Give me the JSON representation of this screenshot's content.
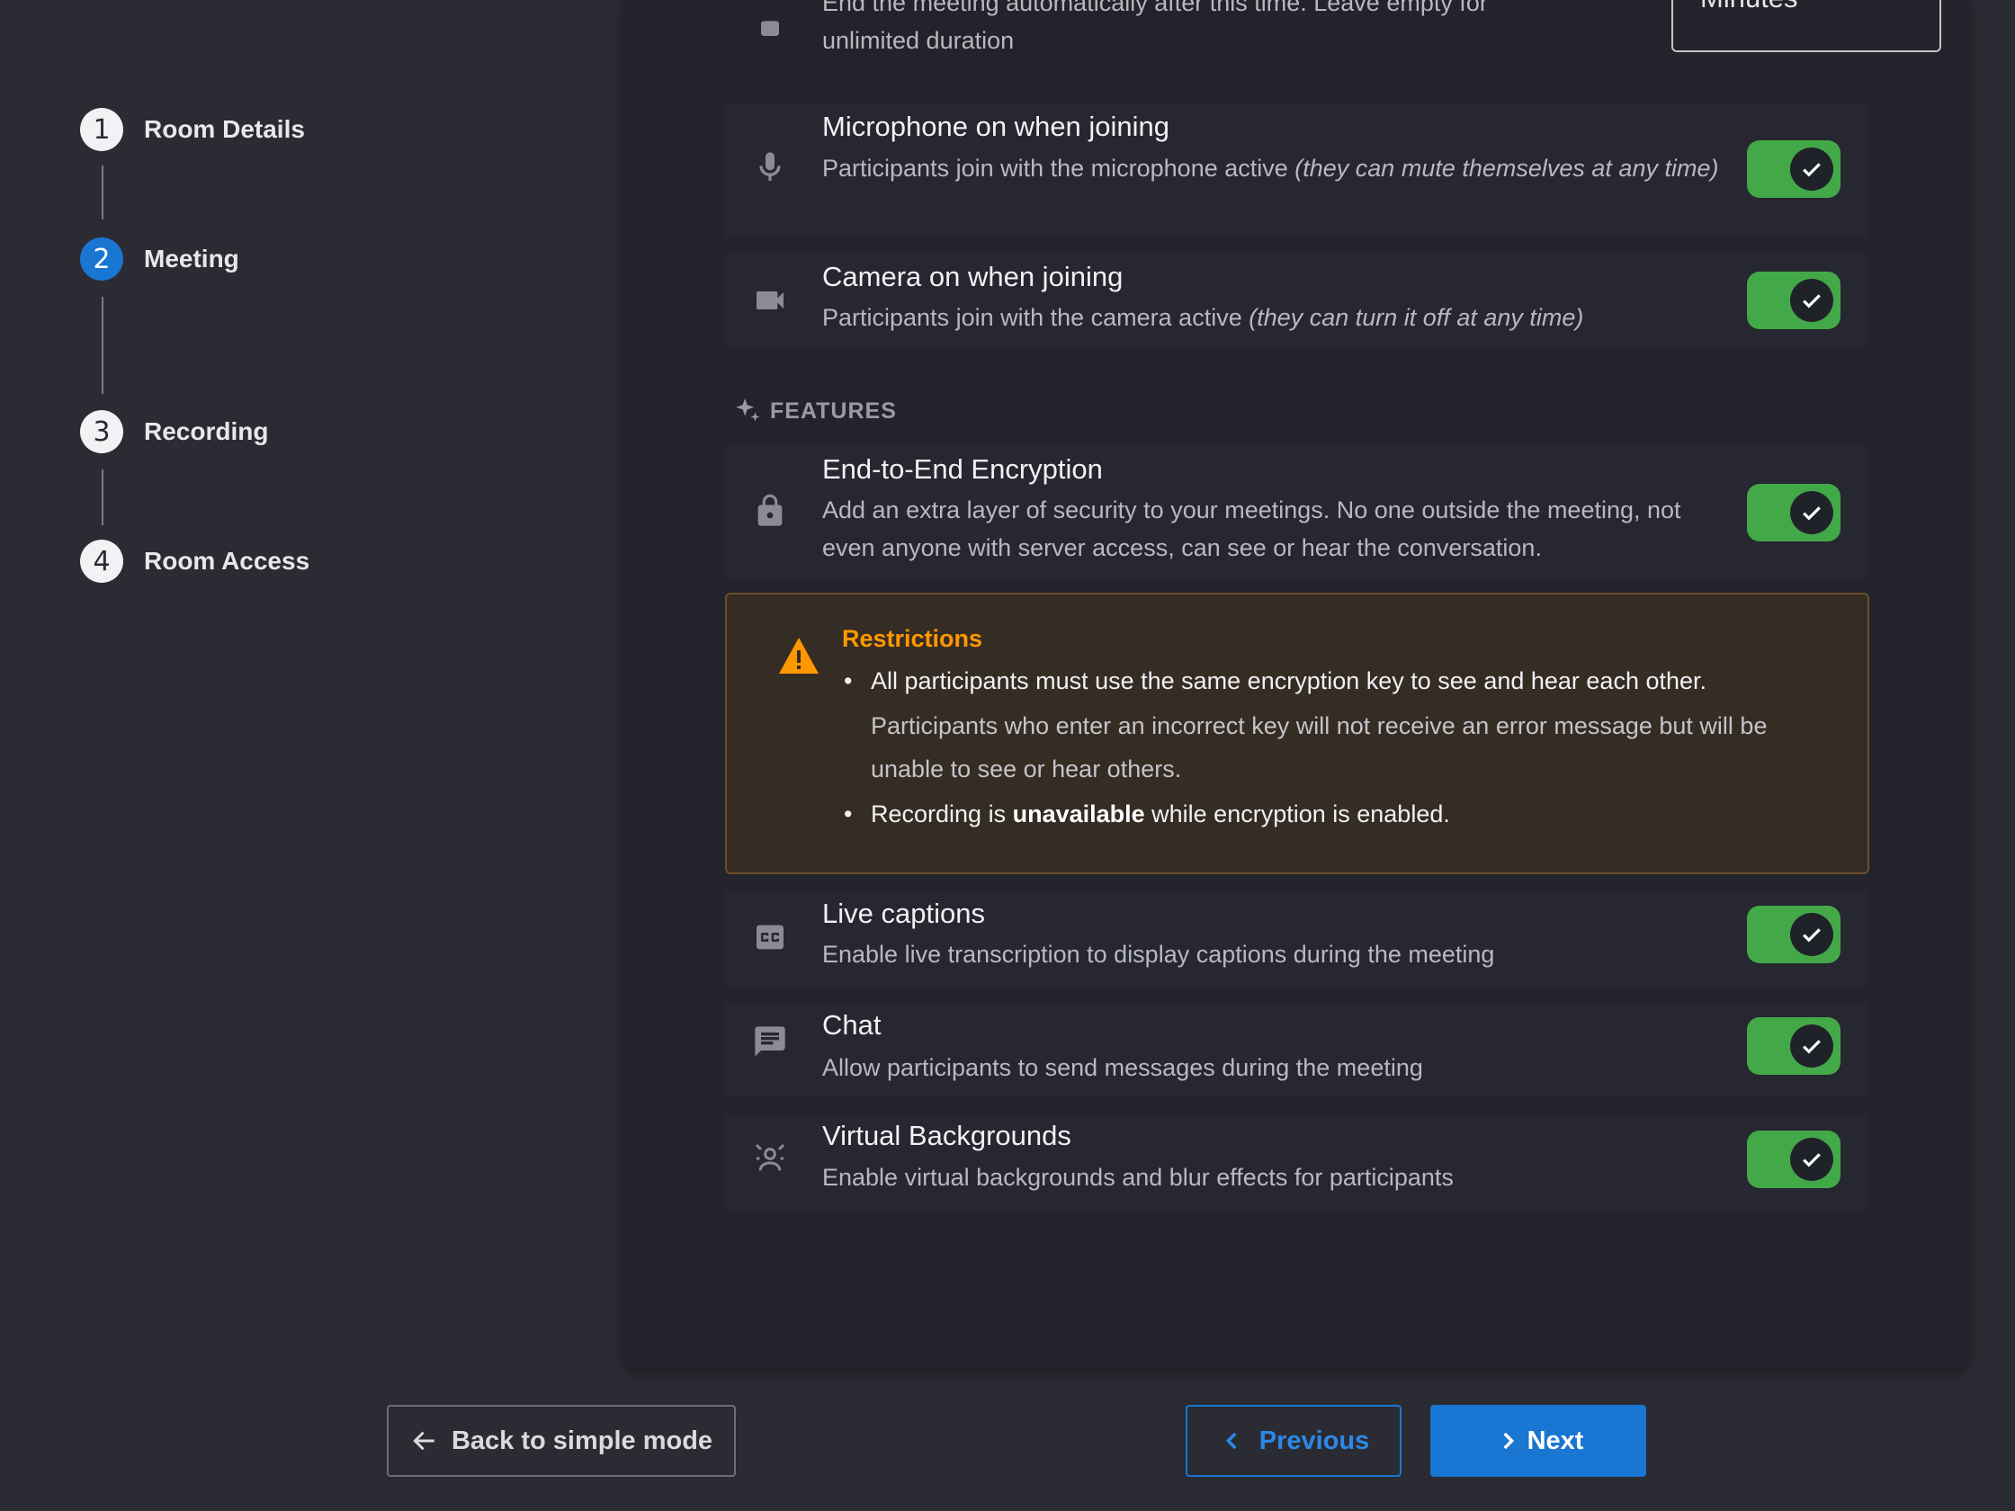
{
  "stepper": {
    "steps": [
      {
        "number": "1",
        "label": "Room Details"
      },
      {
        "number": "2",
        "label": "Meeting"
      },
      {
        "number": "3",
        "label": "Recording"
      },
      {
        "number": "4",
        "label": "Room Access"
      }
    ],
    "active_step": 2
  },
  "duration": {
    "desc_line1": "End the meeting automatically after this time. Leave empty for",
    "desc_line2": "unlimited duration",
    "unit": "Minutes"
  },
  "settings": {
    "microphone": {
      "title": "Microphone on when joining",
      "desc": "Participants join with the microphone active ",
      "desc_em": "(they can mute themselves at any time)",
      "enabled": true,
      "icon": "microphone-icon"
    },
    "camera": {
      "title": "Camera on when joining",
      "desc": "Participants join with the camera active ",
      "desc_em": "(they can turn it off at any time)",
      "enabled": true,
      "icon": "videocam-icon"
    }
  },
  "features": {
    "heading": "FEATURES",
    "icon": "sparkle-icon",
    "encryption": {
      "title": "End-to-End Encryption",
      "desc": "Add an extra layer of security to your meetings. No one outside the meeting, not even anyone with server access, can see or hear the conversation.",
      "enabled": true,
      "icon": "lock-icon"
    },
    "restrictions": {
      "title": "Restrictions",
      "item1": "All participants must use the same encryption key to see and hear each other.",
      "item1_sub": "Participants who enter an incorrect key will not receive an error message but will be unable to see or hear others.",
      "item2_pre": "Recording is ",
      "item2_bold": "unavailable",
      "item2_post": " while encryption is enabled.",
      "icon": "warning-icon",
      "accent": "#ff9800"
    },
    "captions": {
      "title": "Live captions",
      "desc": "Enable live transcription to display captions during the meeting",
      "enabled": true,
      "icon": "closed-caption-icon"
    },
    "chat": {
      "title": "Chat",
      "desc": "Allow participants to send messages during the meeting",
      "enabled": true,
      "icon": "chat-icon"
    },
    "backgrounds": {
      "title": "Virtual Backgrounds",
      "desc": "Enable virtual backgrounds and blur effects for participants",
      "enabled": true,
      "icon": "background-person-icon"
    }
  },
  "footer": {
    "back_label": "Back to simple mode",
    "previous_label": "Previous",
    "next_label": "Next"
  },
  "colors": {
    "accent": "#1976d2",
    "toggle_on": "#43a948",
    "warning": "#ff9800"
  }
}
